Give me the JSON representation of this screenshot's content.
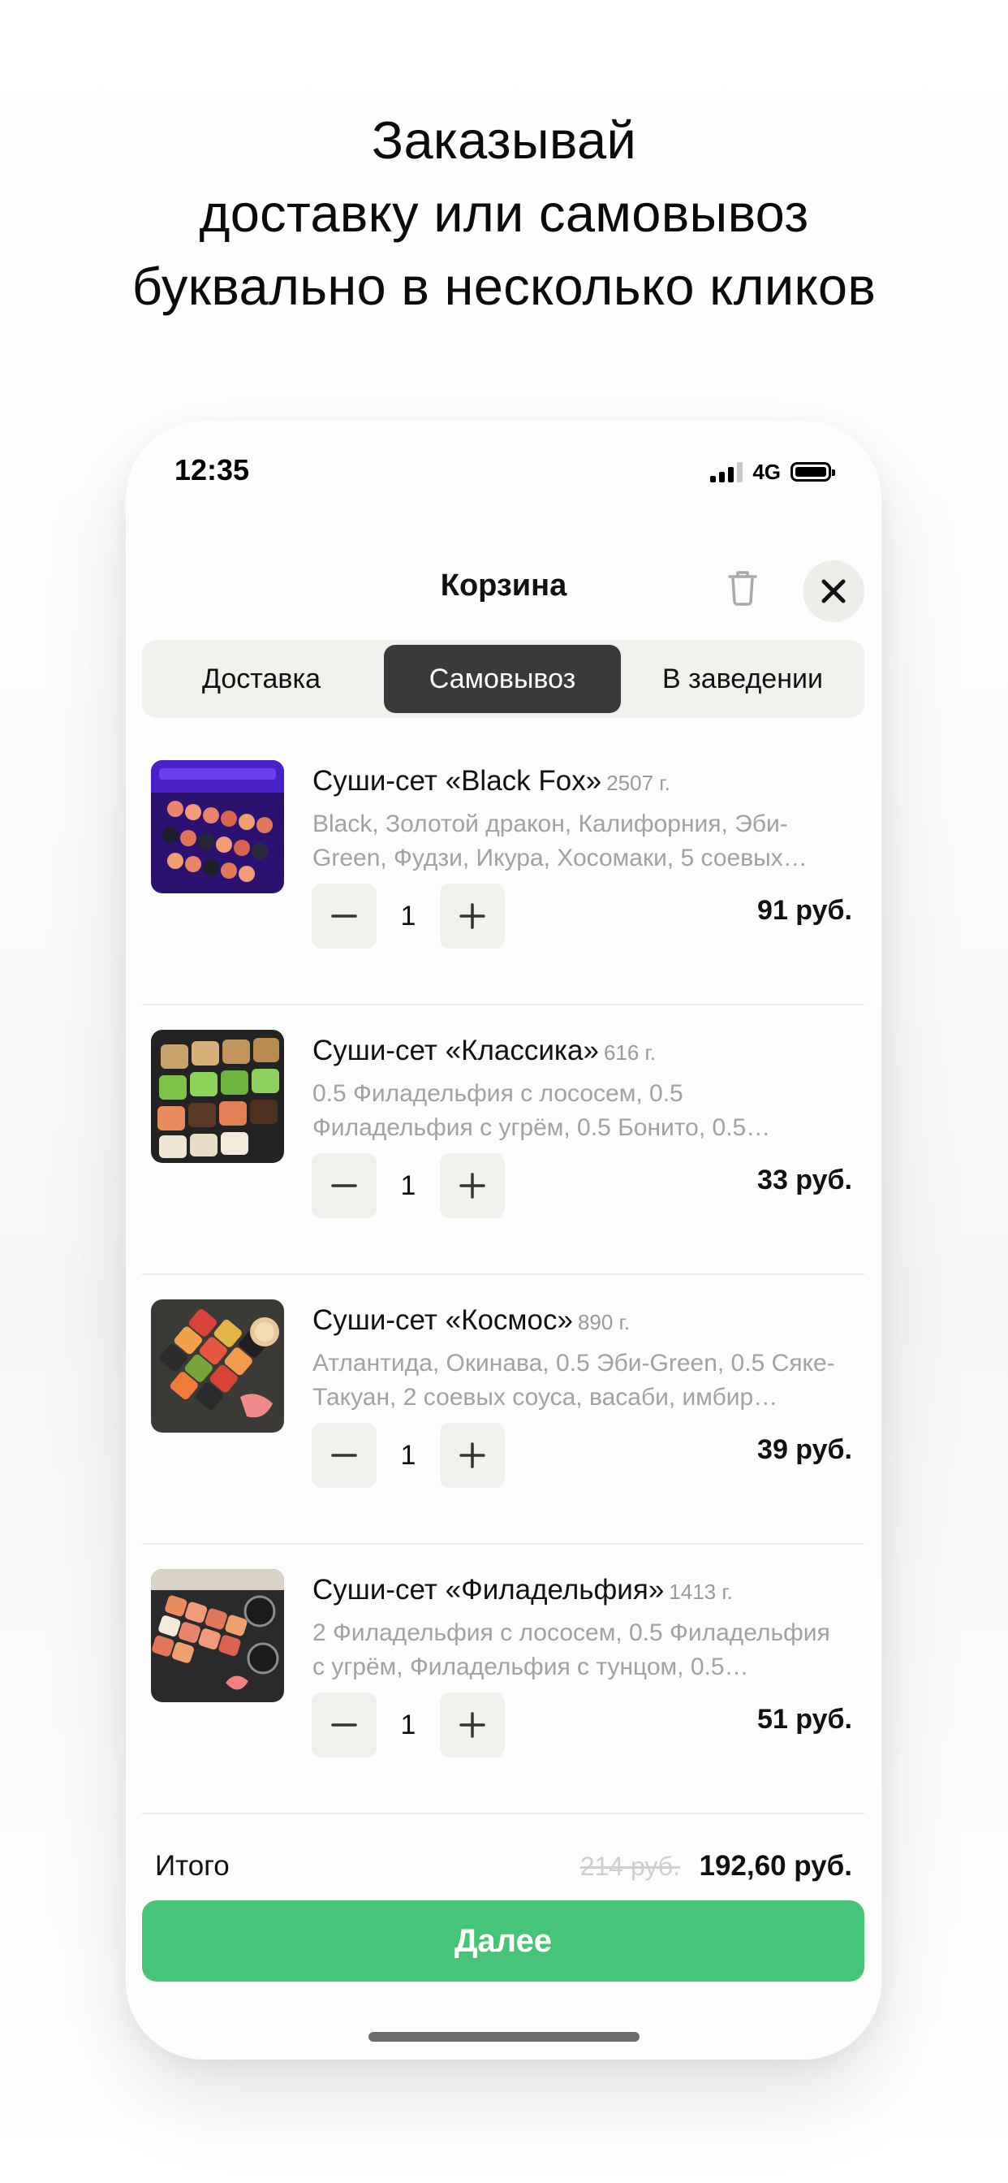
{
  "headline": {
    "line1": "Заказывай",
    "line2": "доставку или самовывоз",
    "line3": "буквально в несколько кликов"
  },
  "status_bar": {
    "time": "12:35",
    "network": "4G",
    "signal_icon": "cellular-signal-icon",
    "battery_icon": "battery-icon"
  },
  "header": {
    "title": "Корзина",
    "trash_icon": "trash-icon",
    "close_icon": "close-icon"
  },
  "order_type_tabs": {
    "selected": "Самовывоз",
    "options": [
      "Доставка",
      "Самовывоз",
      "В заведении"
    ]
  },
  "cart_items": [
    {
      "name": "Суши-сет «Black Fox»",
      "weight": "2507 г.",
      "description": "Black, Золотой дракон, Калифорния, Эби-Green, Фудзи, Икура, Хосомаки, 5 соевых…",
      "quantity": "1",
      "price": "91 руб."
    },
    {
      "name": "Суши-сет «Классика»",
      "weight": "616 г.",
      "description": "0.5 Филадельфия с лососем, 0.5 Филадельфия с угрём, 0.5 Бонито, 0.5…",
      "quantity": "1",
      "price": "33 руб."
    },
    {
      "name": "Суши-сет «Космос»",
      "weight": "890 г.",
      "description": "Атлантида, Окинава, 0.5 Эби-Green, 0.5 Сяке-Такуан, 2 соевых соуса, васаби, имбир…",
      "quantity": "1",
      "price": "39 руб."
    },
    {
      "name": "Суши-сет «Филадельфия»",
      "weight": "1413 г.",
      "description": "2 Филадельфия с лососем, 0.5 Филадельфия с угрём, Филадельфия с тунцом, 0.5…",
      "quantity": "1",
      "price": "51 руб."
    }
  ],
  "summary": {
    "total_label": "Итого",
    "old_total": "214 руб.",
    "new_total": "192,60 руб.",
    "next_button": "Далее"
  },
  "colors": {
    "accent_green": "#46c47a",
    "active_tab": "#3a3a3a",
    "chip_bg": "#f1f0ec"
  }
}
